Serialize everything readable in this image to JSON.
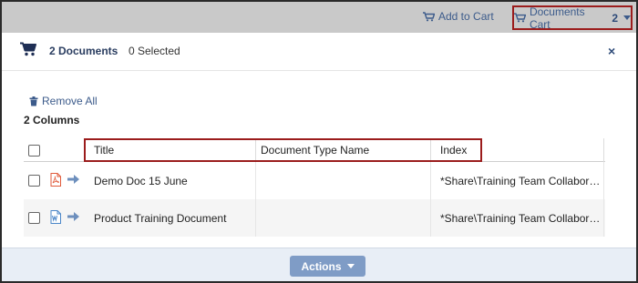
{
  "toolbar": {
    "add_to_cart": "Add to Cart",
    "documents_cart_label": "Documents Cart",
    "documents_cart_count": "2"
  },
  "header": {
    "documents_count": "2 Documents",
    "selected": "0 Selected",
    "close": "×"
  },
  "remove_all": "Remove All",
  "columns_count": "2 Columns",
  "table": {
    "headers": [
      "Title",
      "Document Type Name",
      "Index"
    ],
    "rows": [
      {
        "icon": "pdf-file-icon",
        "title": "Demo Doc 15 June",
        "document_type_name": "",
        "index": "*Share\\Training Team Collabor…"
      },
      {
        "icon": "word-file-icon",
        "title": "Product Training Document",
        "document_type_name": "",
        "index": "*Share\\Training Team Collabor…"
      }
    ]
  },
  "footer": {
    "actions_label": "Actions"
  },
  "colors": {
    "accent_blue": "#3c5b8b",
    "highlight_red": "#9b1c1c",
    "topbar_gray": "#c9c9c9",
    "actions_button": "#7f9cc6"
  }
}
